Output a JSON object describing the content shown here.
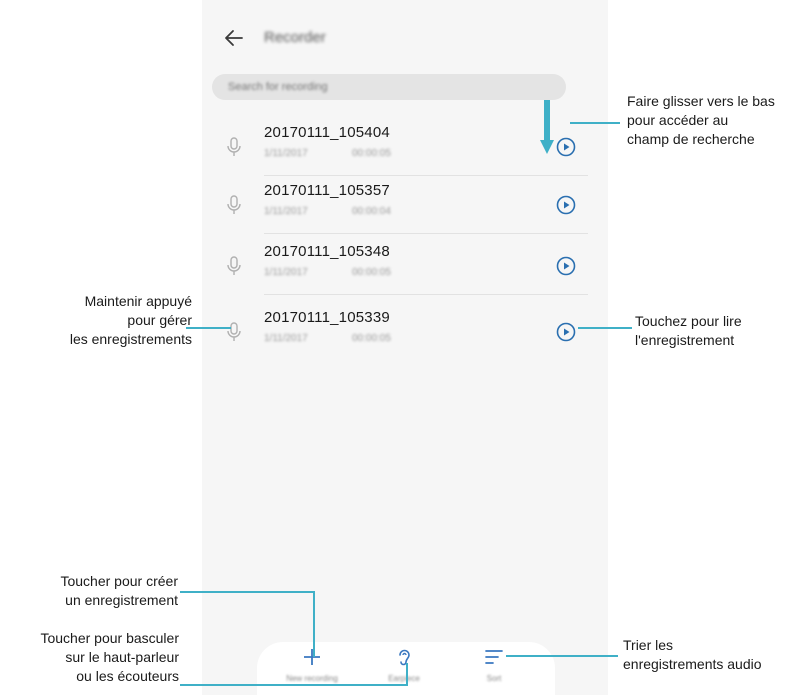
{
  "app": {
    "title": "Recorder",
    "back_icon": "back-arrow-icon"
  },
  "search": {
    "placeholder": "Search for recording"
  },
  "recordings": [
    {
      "name": "20170111_105404",
      "date": "1/11/2017",
      "duration": "00:00:05"
    },
    {
      "name": "20170111_105357",
      "date": "1/11/2017",
      "duration": "00:00:04"
    },
    {
      "name": "20170111_105348",
      "date": "1/11/2017",
      "duration": "00:00:05"
    },
    {
      "name": "20170111_105339",
      "date": "1/11/2017",
      "duration": "00:00:05"
    }
  ],
  "toolbar": {
    "new_label": "New recording",
    "earpiece_label": "Earpiece",
    "sort_label": "Sort"
  },
  "annotations": {
    "swipe": "Faire glisser vers le bas\npour accéder au\nchamp de recherche",
    "hold": "Maintenir appuyé\npour gérer\nles enregistrements",
    "play": "Touchez pour lire\nl'enregistrement",
    "create": "Toucher pour créer\nun enregistrement",
    "speaker": "Toucher pour basculer\nsur le haut-parleur\nou les écouteurs",
    "sort": "Trier les\nenregistrements audio"
  },
  "colors": {
    "accent": "#3fb0c7",
    "play_icon": "#2a6fb0",
    "icon_gray": "#9a9a9a",
    "toolbar_icon": "#3a78c0"
  }
}
